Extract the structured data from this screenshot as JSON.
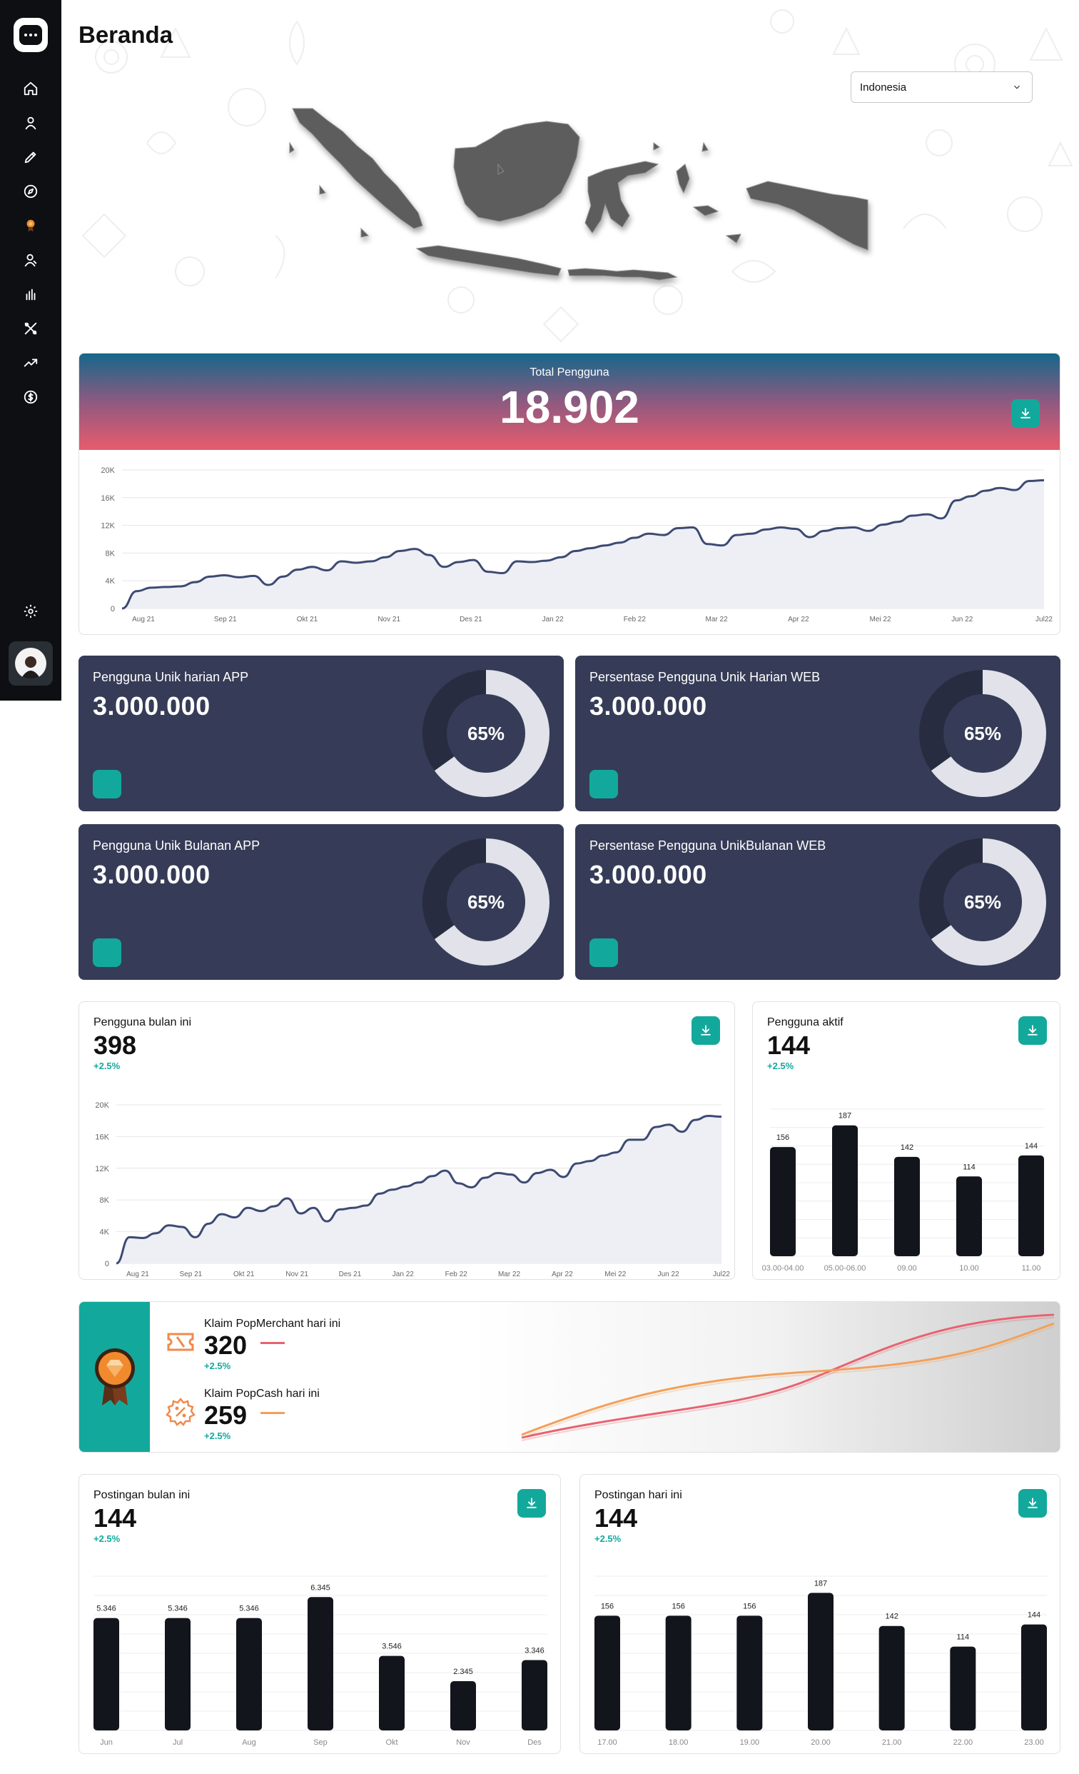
{
  "page": {
    "title": "Beranda"
  },
  "region_select": {
    "value": "Indonesia"
  },
  "sidebar": {
    "items": [
      {
        "name": "home-icon"
      },
      {
        "name": "user-icon"
      },
      {
        "name": "pen-icon"
      },
      {
        "name": "compass-icon"
      },
      {
        "name": "trophy-icon"
      },
      {
        "name": "users-icon"
      },
      {
        "name": "bar-chart-icon"
      },
      {
        "name": "tools-icon"
      },
      {
        "name": "trend-icon"
      },
      {
        "name": "dollar-icon"
      }
    ],
    "settings_icon": "gear-icon"
  },
  "total_users": {
    "label": "Total Pengguna",
    "value": "18.902"
  },
  "stats": [
    {
      "title": "Pengguna Unik harian APP",
      "value": "3.000.000",
      "percent_label": "65%"
    },
    {
      "title": "Persentase Pengguna Unik Harian WEB",
      "value": "3.000.000",
      "percent_label": "65%"
    },
    {
      "title": "Pengguna Unik Bulanan APP",
      "value": "3.000.000",
      "percent_label": "65%"
    },
    {
      "title": "Persentase Pengguna UnikBulanan WEB",
      "value": "3.000.000",
      "percent_label": "65%"
    }
  ],
  "monthly_users": {
    "title": "Pengguna bulan ini",
    "value": "398",
    "change": "+2.5%"
  },
  "active_users": {
    "title": "Pengguna aktif",
    "value": "144",
    "change": "+2.5%"
  },
  "claims": [
    {
      "title": "Klaim PopMerchant hari ini",
      "value": "320",
      "change": "+2.5%",
      "color": "#e8626f"
    },
    {
      "title": "Klaim PopCash hari ini",
      "value": "259",
      "change": "+2.5%",
      "color": "#f2a05a"
    }
  ],
  "posts_month": {
    "title": "Postingan bulan ini",
    "value": "144",
    "change": "+2.5%"
  },
  "posts_today": {
    "title": "Postingan hari ini",
    "value": "144",
    "change": "+2.5%"
  },
  "colors": {
    "accent": "#12a99c",
    "card_dark": "#363c57",
    "line": "#3d4a72",
    "bar": "#12151c"
  },
  "chart_data": [
    {
      "id": "total-users-line",
      "type": "area",
      "x": [
        "Aug 21",
        "Sep 21",
        "Okt 21",
        "Nov 21",
        "Des 21",
        "Jan 22",
        "Feb 22",
        "Mar 22",
        "Apr 22",
        "Mei 22",
        "Jun 22",
        "Jul22"
      ],
      "yticks": [
        "0",
        "4K",
        "8K",
        "12K",
        "16K",
        "20K"
      ],
      "ylim": [
        0,
        20000
      ],
      "values": [
        0,
        2500,
        3000,
        3100,
        3200,
        3800,
        4600,
        4800,
        4500,
        4700,
        3400,
        4600,
        5600,
        6000,
        5500,
        6800,
        6600,
        6800,
        7400,
        8300,
        8600,
        7700,
        6000,
        6700,
        7000,
        5300,
        5100,
        6800,
        6700,
        6900,
        7400,
        8300,
        8700,
        9100,
        9500,
        10200,
        10800,
        10600,
        11600,
        11700,
        9300,
        9100,
        10600,
        10800,
        11400,
        11700,
        11500,
        10300,
        11200,
        11600,
        11700,
        11200,
        12100,
        12500,
        13400,
        13600,
        13000,
        15600,
        16200,
        17000,
        17400,
        17100,
        18400,
        18500
      ]
    },
    {
      "id": "monthly-users-line",
      "type": "area",
      "x": [
        "Aug 21",
        "Sep 21",
        "Okt 21",
        "Nov 21",
        "Des 21",
        "Jan 22",
        "Feb 22",
        "Mar 22",
        "Apr 22",
        "Mei 22",
        "Jun 22",
        "Jul22"
      ],
      "yticks": [
        "0",
        "4K",
        "8K",
        "12K",
        "16K",
        "20K"
      ],
      "ylim": [
        0,
        20000
      ],
      "values": [
        0,
        3300,
        3200,
        3800,
        4800,
        4600,
        3300,
        5000,
        6200,
        5800,
        7000,
        6600,
        7200,
        8200,
        6300,
        7000,
        5300,
        6800,
        7000,
        7300,
        8800,
        9300,
        9700,
        10200,
        11000,
        11700,
        10100,
        9600,
        10800,
        11400,
        11200,
        10200,
        11400,
        11800,
        10900,
        12600,
        12900,
        13600,
        14000,
        15600,
        15600,
        17200,
        17500,
        16600,
        18100,
        18600,
        18500
      ]
    },
    {
      "id": "active-users-bar",
      "type": "bar",
      "categories": [
        "03.00-04.00",
        "05.00-06.00",
        "09.00",
        "10.00",
        "11.00"
      ],
      "values": [
        156,
        187,
        142,
        114,
        144
      ],
      "ylim": [
        0,
        200
      ]
    },
    {
      "id": "posts-month-bar",
      "type": "bar",
      "categories": [
        "Jun",
        "Jul",
        "Aug",
        "Sep",
        "Okt",
        "Nov",
        "Des"
      ],
      "values": [
        5346,
        5346,
        5346,
        6345,
        3546,
        2345,
        3346
      ],
      "labels": [
        "5.346",
        "5.346",
        "5.346",
        "6.345",
        "3.546",
        "2.345",
        "3.346"
      ],
      "ylim": [
        0,
        7000
      ]
    },
    {
      "id": "posts-today-bar",
      "type": "bar",
      "categories": [
        "17.00",
        "18.00",
        "19.00",
        "20.00",
        "21.00",
        "22.00",
        "23.00"
      ],
      "values": [
        156,
        156,
        156,
        187,
        142,
        114,
        144
      ],
      "labels": [
        "156",
        "156",
        "156",
        "187",
        "142",
        "114",
        "144"
      ],
      "ylim": [
        0,
        200
      ]
    }
  ]
}
